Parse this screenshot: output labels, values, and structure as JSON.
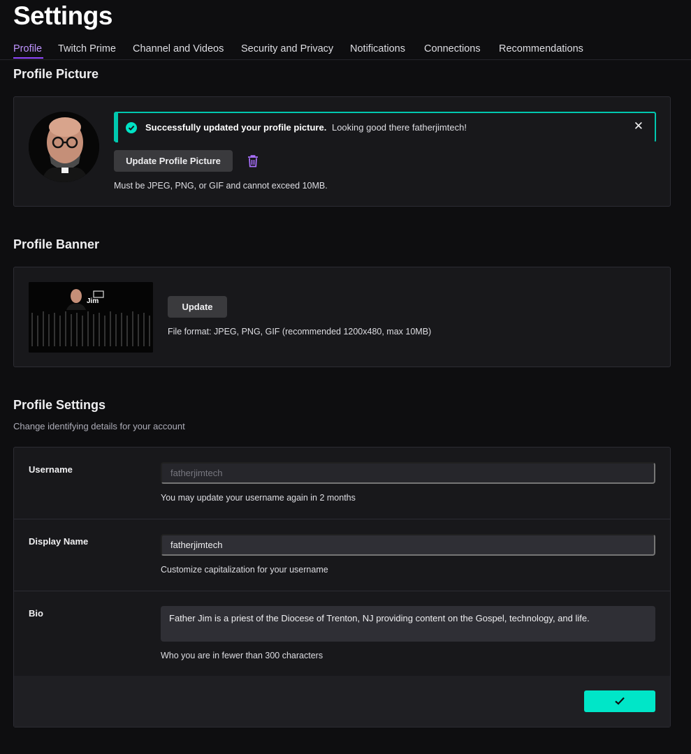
{
  "page": {
    "title": "Settings"
  },
  "tabs": [
    {
      "label": "Profile",
      "active": true
    },
    {
      "label": "Twitch Prime"
    },
    {
      "label": "Channel and Videos"
    },
    {
      "label": "Security and Privacy"
    },
    {
      "label": "Notifications"
    },
    {
      "label": "Connections"
    },
    {
      "label": "Recommendations"
    }
  ],
  "profile_picture": {
    "title": "Profile Picture",
    "alert": {
      "strong": "Successfully updated your profile picture.",
      "message": "Looking good there fatherjimtech!",
      "icon": "check-circle-icon",
      "close_icon": "close-icon"
    },
    "update_button": "Update Profile Picture",
    "delete_icon": "trash-icon",
    "hint": "Must be JPEG, PNG, or GIF and cannot exceed 10MB."
  },
  "profile_banner": {
    "title": "Profile Banner",
    "update_button": "Update",
    "hint": "File format: JPEG, PNG, GIF (recommended 1200x480, max 10MB)",
    "banner_logo_text": "Jim"
  },
  "profile_settings": {
    "title": "Profile Settings",
    "subtitle": "Change identifying details for your account",
    "username": {
      "label": "Username",
      "value": "fatherjimtech",
      "hint": "You may update your username again in 2 months"
    },
    "display_name": {
      "label": "Display Name",
      "value": "fatherjimtech",
      "hint": "Customize capitalization for your username"
    },
    "bio": {
      "label": "Bio",
      "value": "Father Jim is a priest of the Diocese of Trenton, NJ providing content on the Gospel, technology, and life.",
      "hint": "Who you are in fewer than 300 characters"
    },
    "save_icon": "checkmark-icon"
  },
  "colors": {
    "background": "#0e0e10",
    "card": "#18181b",
    "accent_purple": "#9147ff",
    "active_tab": "#bf94ff",
    "success_teal": "#00e6c8"
  }
}
